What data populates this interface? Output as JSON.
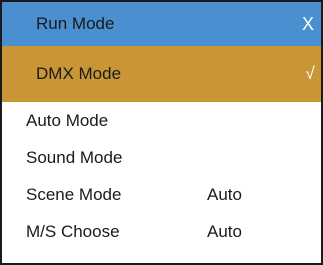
{
  "window": {
    "title": "Run Mode",
    "close_label": "X"
  },
  "menu": {
    "items": [
      {
        "label": "DMX Mode",
        "value": "",
        "check": "√",
        "selected": true
      },
      {
        "label": "Auto Mode",
        "value": ""
      },
      {
        "label": "Sound Mode",
        "value": ""
      },
      {
        "label": "Scene Mode",
        "value": "Auto"
      },
      {
        "label": "M/S Choose",
        "value": "Auto"
      }
    ]
  },
  "colors": {
    "titlebar": "#4a8fd0",
    "selected_row": "#c99635",
    "border": "#1a1a1a"
  }
}
